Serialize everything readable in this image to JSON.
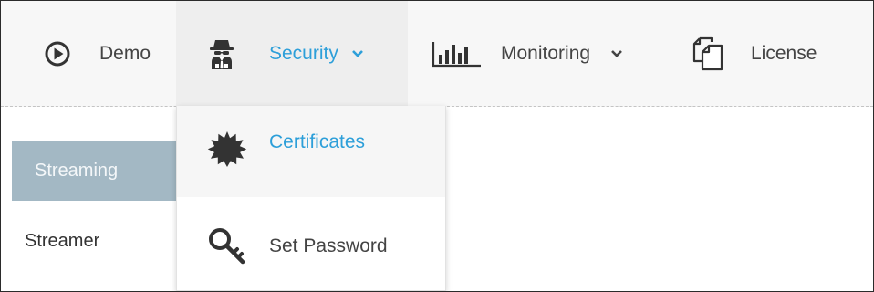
{
  "topnav": {
    "items": [
      {
        "label": "Demo",
        "icon": "play-circle-icon",
        "has_dropdown": false,
        "active": false
      },
      {
        "label": "Security",
        "icon": "spy-agent-icon",
        "has_dropdown": true,
        "active": true
      },
      {
        "label": "Monitoring",
        "icon": "bar-chart-icon",
        "has_dropdown": true,
        "active": false
      },
      {
        "label": "License",
        "icon": "documents-icon",
        "has_dropdown": false,
        "active": false
      }
    ]
  },
  "sidebar": {
    "items": [
      {
        "label": "Streaming",
        "selected": true
      },
      {
        "label": "Streamer",
        "selected": false
      }
    ]
  },
  "security_menu": {
    "items": [
      {
        "label": "Certificates",
        "icon": "certificate-seal-icon",
        "highlighted": true
      },
      {
        "label": "Set Password",
        "icon": "key-icon",
        "highlighted": false
      }
    ]
  },
  "colors": {
    "accent": "#2d9fd9",
    "nav_background": "#f7f7f7",
    "active_background": "#eeeeee",
    "sidebar_selected": "#a3b8c4",
    "text": "#444444"
  }
}
